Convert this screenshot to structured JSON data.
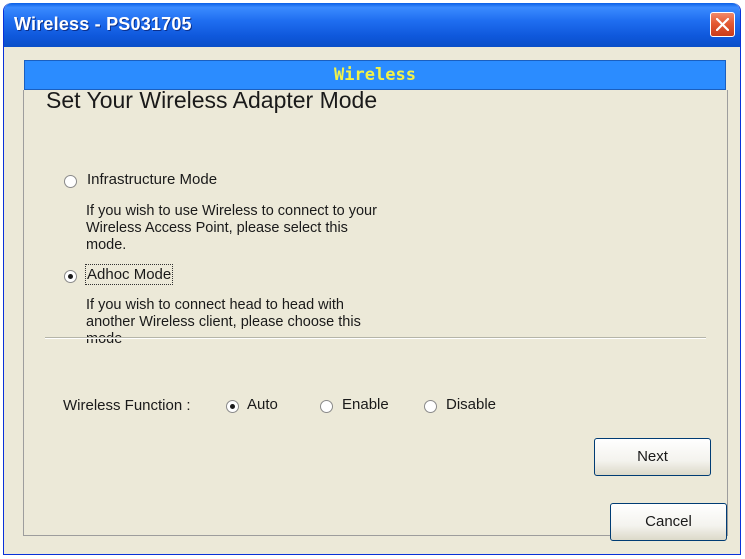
{
  "window": {
    "title": "Wireless - PS031705"
  },
  "banner": {
    "text": "Wireless"
  },
  "main": {
    "heading": "Set Your Wireless Adapter Mode",
    "modes": [
      {
        "label": "Infrastructure Mode",
        "selected": false,
        "desc": [
          "If you wish to use Wireless to connect to your",
          "Wireless Access Point, please select this",
          "mode."
        ]
      },
      {
        "label": "Adhoc Mode",
        "selected": true,
        "desc": [
          "If you wish to connect head to head with",
          "another Wireless client, please choose this",
          "mode"
        ]
      }
    ],
    "wireless_function": {
      "label": "Wireless Function :",
      "options": [
        {
          "label": "Auto",
          "selected": true
        },
        {
          "label": "Enable",
          "selected": false
        },
        {
          "label": "Disable",
          "selected": false
        }
      ]
    }
  },
  "buttons": {
    "next": "Next",
    "cancel": "Cancel"
  },
  "colors": {
    "titlebar": "#0a5fe6",
    "banner": "#2b8cff",
    "banner_text": "#f2f24a",
    "close": "#e45a33"
  }
}
